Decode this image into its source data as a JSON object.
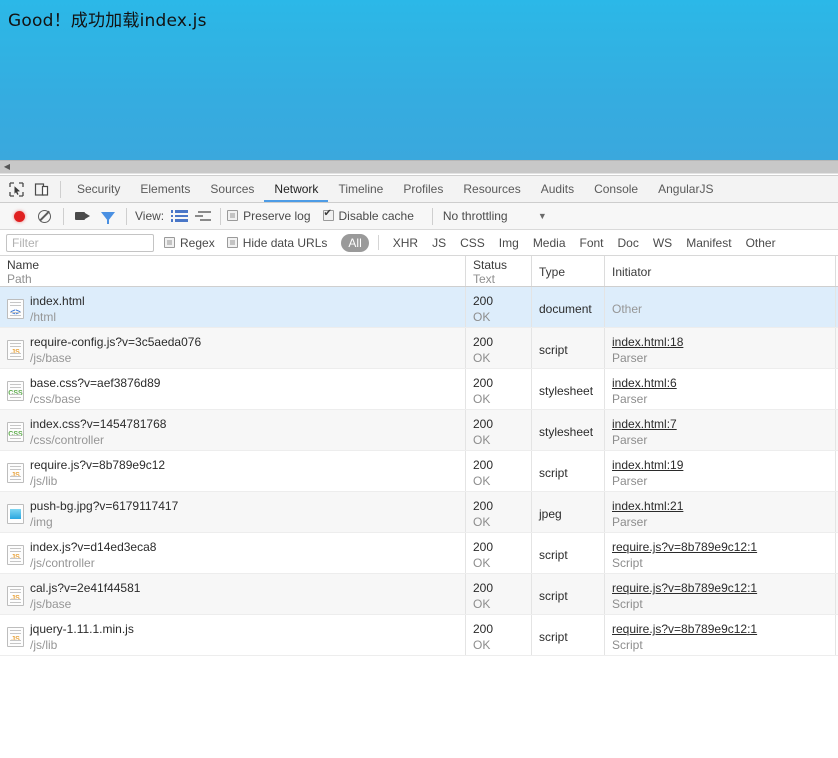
{
  "page": {
    "heading": "Good！成功加载index.js",
    "background_top": "#2bb8e8",
    "background_bottom": "#3aa8dd"
  },
  "scrollbar": {
    "left_arrow": "◀"
  },
  "devtools": {
    "left_icons": [
      {
        "name": "inspect-element-icon",
        "glyph": "inspect"
      },
      {
        "name": "device-toolbar-icon",
        "glyph": "device"
      }
    ],
    "tabs": [
      {
        "label": "Security",
        "active": false
      },
      {
        "label": "Elements",
        "active": false
      },
      {
        "label": "Sources",
        "active": false
      },
      {
        "label": "Network",
        "active": true
      },
      {
        "label": "Timeline",
        "active": false
      },
      {
        "label": "Profiles",
        "active": false
      },
      {
        "label": "Resources",
        "active": false
      },
      {
        "label": "Audits",
        "active": false
      },
      {
        "label": "Console",
        "active": false
      },
      {
        "label": "AngularJS",
        "active": false
      }
    ],
    "controls": {
      "record_title": "record",
      "clear_title": "clear",
      "capture_screenshots_title": "camera",
      "filter_toggle_title": "filter",
      "view_label": "View:",
      "preserve_log_label": "Preserve log",
      "preserve_log_checked": false,
      "disable_cache_label": "Disable cache",
      "disable_cache_checked": true,
      "throttling_value": "No throttling",
      "caret": "▼"
    },
    "filter": {
      "placeholder": "Filter",
      "value": "",
      "regex_label": "Regex",
      "regex_checked": false,
      "hide_data_urls_label": "Hide data URLs",
      "hide_data_urls_checked": false,
      "types": [
        "All",
        "XHR",
        "JS",
        "CSS",
        "Img",
        "Media",
        "Font",
        "Doc",
        "WS",
        "Manifest",
        "Other"
      ],
      "active_type": "All"
    },
    "table": {
      "columns": [
        {
          "title": "Name",
          "subtitle": "Path"
        },
        {
          "title": "Status",
          "subtitle": "Text"
        },
        {
          "title": "Type",
          "subtitle": ""
        },
        {
          "title": "Initiator",
          "subtitle": ""
        }
      ],
      "rows": [
        {
          "icon": "html-file-icon",
          "icon_kind": "html",
          "name": "index.html",
          "path": "/html",
          "status": "200",
          "status_text": "OK",
          "type": "document",
          "initiator": "Other",
          "initiator_sub": "",
          "initiator_is_link": false,
          "selected": true
        },
        {
          "icon": "js-file-icon",
          "icon_kind": "js",
          "name": "require-config.js?v=3c5aeda076",
          "path": "/js/base",
          "status": "200",
          "status_text": "OK",
          "type": "script",
          "initiator": "index.html:18",
          "initiator_sub": "Parser",
          "initiator_is_link": true,
          "selected": false
        },
        {
          "icon": "css-file-icon",
          "icon_kind": "css",
          "name": "base.css?v=aef3876d89",
          "path": "/css/base",
          "status": "200",
          "status_text": "OK",
          "type": "stylesheet",
          "initiator": "index.html:6",
          "initiator_sub": "Parser",
          "initiator_is_link": true,
          "selected": false
        },
        {
          "icon": "css-file-icon",
          "icon_kind": "css",
          "name": "index.css?v=1454781768",
          "path": "/css/controller",
          "status": "200",
          "status_text": "OK",
          "type": "stylesheet",
          "initiator": "index.html:7",
          "initiator_sub": "Parser",
          "initiator_is_link": true,
          "selected": false
        },
        {
          "icon": "js-file-icon",
          "icon_kind": "js",
          "name": "require.js?v=8b789e9c12",
          "path": "/js/lib",
          "status": "200",
          "status_text": "OK",
          "type": "script",
          "initiator": "index.html:19",
          "initiator_sub": "Parser",
          "initiator_is_link": true,
          "selected": false
        },
        {
          "icon": "image-file-icon",
          "icon_kind": "img",
          "name": "push-bg.jpg?v=6179117417",
          "path": "/img",
          "status": "200",
          "status_text": "OK",
          "type": "jpeg",
          "initiator": "index.html:21",
          "initiator_sub": "Parser",
          "initiator_is_link": true,
          "selected": false
        },
        {
          "icon": "js-file-icon",
          "icon_kind": "js",
          "name": "index.js?v=d14ed3eca8",
          "path": "/js/controller",
          "status": "200",
          "status_text": "OK",
          "type": "script",
          "initiator": "require.js?v=8b789e9c12:1",
          "initiator_sub": "Script",
          "initiator_is_link": true,
          "selected": false
        },
        {
          "icon": "js-file-icon",
          "icon_kind": "js",
          "name": "cal.js?v=2e41f44581",
          "path": "/js/base",
          "status": "200",
          "status_text": "OK",
          "type": "script",
          "initiator": "require.js?v=8b789e9c12:1",
          "initiator_sub": "Script",
          "initiator_is_link": true,
          "selected": false
        },
        {
          "icon": "js-file-icon",
          "icon_kind": "js",
          "name": "jquery-1.11.1.min.js",
          "path": "/js/lib",
          "status": "200",
          "status_text": "OK",
          "type": "script",
          "initiator": "require.js?v=8b789e9c12:1",
          "initiator_sub": "Script",
          "initiator_is_link": true,
          "selected": false
        }
      ]
    }
  }
}
